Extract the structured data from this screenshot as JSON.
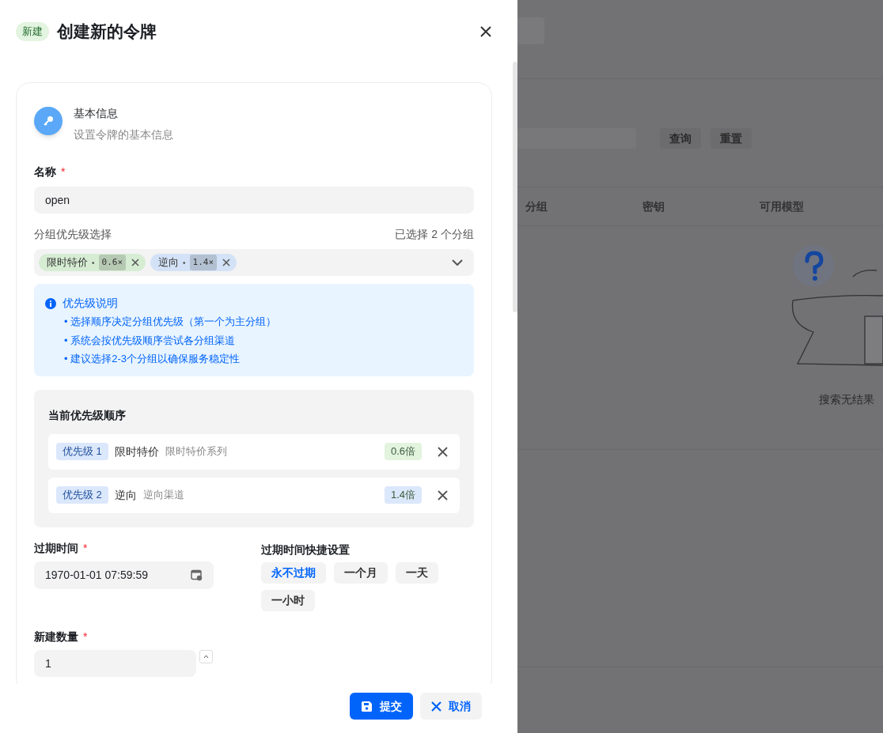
{
  "dialog": {
    "badge": "新建",
    "title": "创建新的令牌"
  },
  "section": {
    "title": "基本信息",
    "subtitle": "设置令牌的基本信息"
  },
  "name_field": {
    "label": "名称",
    "required_mark": "*",
    "value": "open"
  },
  "group_select": {
    "label": "分组优先级选择",
    "count_text": "已选择 2 个分组",
    "tags": [
      {
        "name": "限时特价",
        "separator": "•",
        "ratio": "0.6×",
        "color": "#d6edd3"
      },
      {
        "name": "逆向",
        "separator": "•",
        "ratio": "1.4×",
        "color": "#d3e2f6"
      }
    ]
  },
  "info": {
    "title": "优先级说明",
    "items": [
      "• 选择顺序决定分组优先级（第一个为主分组）",
      "• 系统会按优先级顺序尝试各分组渠道",
      "• 建议选择2-3个分组以确保服务稳定性"
    ]
  },
  "priority_order": {
    "title": "当前优先级顺序",
    "rows": [
      {
        "badge": "优先级 1",
        "name": "限时特价",
        "description": "限时特价系列",
        "ratio": "0.6倍",
        "color": "#e2f3de"
      },
      {
        "badge": "优先级 2",
        "name": "逆向",
        "description": "逆向渠道",
        "ratio": "1.4倍",
        "color": "#dbe7fb"
      }
    ]
  },
  "expire_field": {
    "label": "过期时间",
    "required_mark": "*",
    "value": "1970-01-01 07:59:59"
  },
  "quick_expire": {
    "label": "过期时间快捷设置",
    "options": [
      {
        "label": "永不过期",
        "selected": true
      },
      {
        "label": "一个月",
        "selected": false
      },
      {
        "label": "一天",
        "selected": false
      },
      {
        "label": "一小时",
        "selected": false
      }
    ]
  },
  "count_field": {
    "label": "新建数量",
    "required_mark": "*",
    "value": "1"
  },
  "footer_buttons": [
    {
      "kind": "primary",
      "label": "提交"
    },
    {
      "kind": "secondary",
      "label": "取消"
    }
  ],
  "background": {
    "buttons": [
      "查询",
      "重置"
    ],
    "columns": [
      "分组",
      "密钥",
      "可用模型"
    ],
    "empty_text": "搜索无结果"
  }
}
